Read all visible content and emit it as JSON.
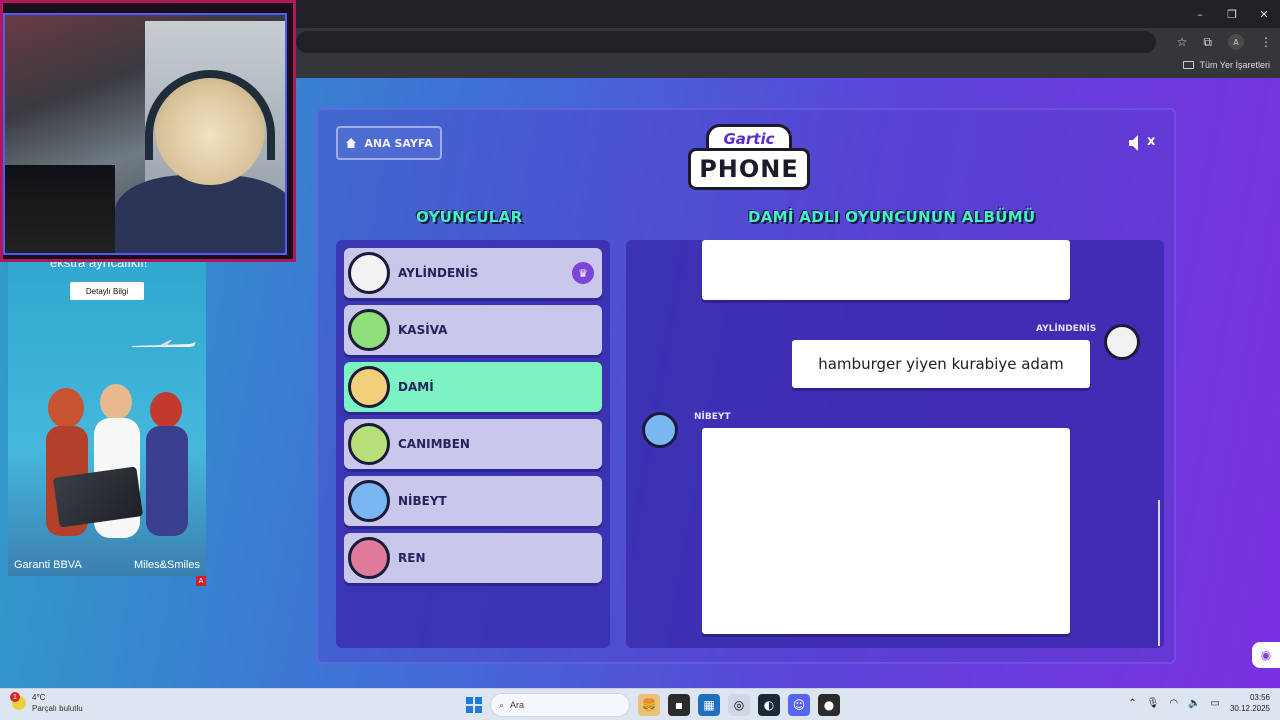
{
  "browser": {
    "window_controls": {
      "minimize": "–",
      "restore": "❐",
      "close": "✕"
    },
    "profile_initial": "A",
    "bookmarks_folder_label": "Tüm Yer İşaretleri"
  },
  "webcam": {
    "caption": "ekstra ayrıcalıklı!"
  },
  "ad": {
    "button_label": "Detaylı Bilgi",
    "brand_left": "Garanti BBVA",
    "brand_right": "Miles&Smiles",
    "ad_marker": "A"
  },
  "game": {
    "home_button_label": "ANA SAYFA",
    "logo_top": "Gartic",
    "logo_main": "PHONE",
    "mute_symbol": "x",
    "players_title": "OYUNCULAR",
    "album_title": "DAMİ ADLI OYUNCUNUN ALBÜMÜ",
    "players": [
      {
        "name": "AYLİNDENİS",
        "host": true,
        "active": false,
        "avatar_color": "#f2f2f2"
      },
      {
        "name": "KASİVA",
        "host": false,
        "active": false,
        "avatar_color": "#8fe07a"
      },
      {
        "name": "DAMİ",
        "host": false,
        "active": true,
        "avatar_color": "#f2d07a"
      },
      {
        "name": "CANIMBEN",
        "host": false,
        "active": false,
        "avatar_color": "#b6e07a"
      },
      {
        "name": "NİBEYT",
        "host": false,
        "active": false,
        "avatar_color": "#7ab6f2"
      },
      {
        "name": "REN",
        "host": false,
        "active": false,
        "avatar_color": "#e07a9a"
      }
    ],
    "album": {
      "messages": [
        {
          "author": "AYLİNDENİS",
          "text": "hamburger yiyen kurabiye adam"
        },
        {
          "author": "NİBEYT",
          "text": ""
        }
      ]
    },
    "host_icon": "♛"
  },
  "taskbar": {
    "weather_temp": "4°C",
    "weather_desc": "Parçalı bulutlu",
    "weather_badge": "1",
    "search_placeholder": "Ara",
    "clock_time": "03:56",
    "clock_date": "30.12.2025"
  }
}
